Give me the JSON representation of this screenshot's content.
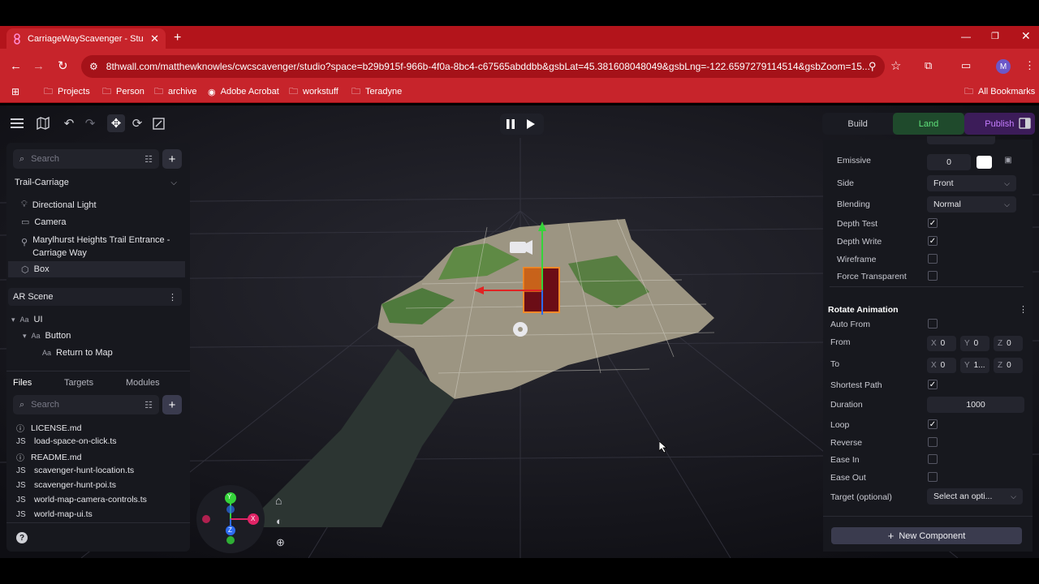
{
  "browser": {
    "tab_title": "CarriageWayScavenger - Studio",
    "url": "8thwall.com/matthewknowles/cwcscavenger/studio?space=b29b915f-966b-4f0a-8bc4-c67565abddbb&gsbLat=45.381608048049&gsbLng=-122.6597279114514&gsbZoom=15...",
    "profile_initial": "M",
    "bookmarks": [
      "Projects",
      "Person",
      "archive",
      "Adobe Acrobat",
      "workstuff",
      "Teradyne"
    ],
    "all_bookmarks": "All Bookmarks"
  },
  "toolbar": {
    "modes": [
      "Build",
      "Land",
      "Publish"
    ],
    "active_mode": "Land",
    "colors": {
      "land": "#5fe07a",
      "publish": "#c47dff",
      "accent": "#c7242b"
    }
  },
  "left_panel": {
    "search_placeholder": "Search",
    "scene_name": "Trail-Carriage",
    "scene_items": [
      "Directional Light",
      "Camera",
      "Marylhurst Heights Trail Entrance - Carriage Way",
      "Box"
    ],
    "selected_item": "Box",
    "ar_scene": {
      "title": "AR Scene",
      "items": [
        "UI",
        "Button",
        "Return to Map"
      ]
    },
    "files_tabs": [
      "Files",
      "Targets",
      "Modules"
    ],
    "files_search_placeholder": "Search",
    "files": [
      {
        "icon": "info",
        "name": "LICENSE.md"
      },
      {
        "icon": "JS",
        "name": "load-space-on-click.ts"
      },
      {
        "icon": "info",
        "name": "README.md"
      },
      {
        "icon": "JS",
        "name": "scavenger-hunt-location.ts"
      },
      {
        "icon": "JS",
        "name": "scavenger-hunt-poi.ts"
      },
      {
        "icon": "JS",
        "name": "world-map-camera-controls.ts"
      },
      {
        "icon": "JS",
        "name": "world-map-ui.ts"
      }
    ]
  },
  "gizmo": {
    "x": "X",
    "y": "Y",
    "z": "Z"
  },
  "material": {
    "emissive_label": "Emissive",
    "emissive_value": "0",
    "side_label": "Side",
    "side_value": "Front",
    "blending_label": "Blending",
    "blending_value": "Normal",
    "depth_test_label": "Depth Test",
    "depth_test": true,
    "depth_write_label": "Depth Write",
    "depth_write": true,
    "wireframe_label": "Wireframe",
    "wireframe": false,
    "force_transparent_label": "Force Transparent",
    "force_transparent": false
  },
  "rotate_animation": {
    "title": "Rotate Animation",
    "auto_from_label": "Auto From",
    "auto_from": false,
    "from_label": "From",
    "from": {
      "x": "0",
      "y": "0",
      "z": "0"
    },
    "to_label": "To",
    "to": {
      "x": "0",
      "y": "1...",
      "z": "0"
    },
    "shortest_path_label": "Shortest Path",
    "shortest_path": true,
    "duration_label": "Duration",
    "duration": "1000",
    "loop_label": "Loop",
    "loop": true,
    "reverse_label": "Reverse",
    "reverse": false,
    "ease_in_label": "Ease In",
    "ease_in": false,
    "ease_out_label": "Ease Out",
    "ease_out": false,
    "target_label": "Target (optional)",
    "target_placeholder": "Select an opti..."
  },
  "new_component_label": "New Component"
}
